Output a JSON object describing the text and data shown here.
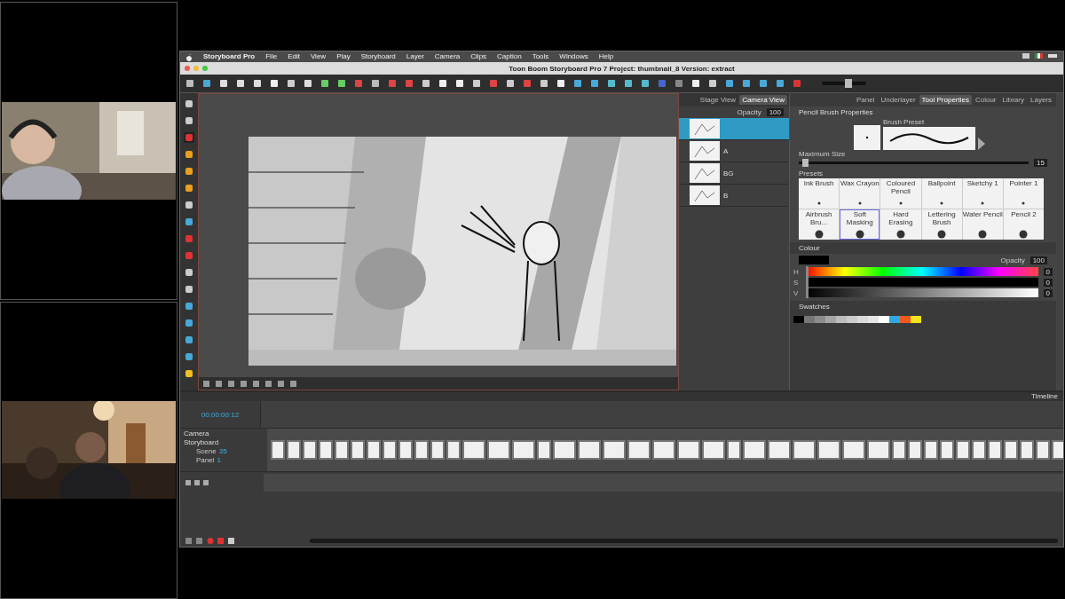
{
  "menu_bar": {
    "items": [
      "Storyboard Pro",
      "File",
      "Edit",
      "View",
      "Play",
      "Storyboard",
      "Layer",
      "Camera",
      "Clips",
      "Caption",
      "Tools",
      "Windows",
      "Help"
    ]
  },
  "toolbar": {
    "zoom": {
      "level": 0.6
    }
  },
  "window": {
    "title": "Toon Boom Storyboard Pro 7 Project: thumbnail_8 Version: extract"
  },
  "view_tabs": [
    {
      "label": "Stage View",
      "selected": false
    },
    {
      "label": "Camera View",
      "selected": true
    }
  ],
  "layers": {
    "opacity_label": "Opacity",
    "opacity": "100",
    "items": [
      {
        "selected": true
      },
      {
        "name": "A",
        "selected": false
      },
      {
        "name": "BG",
        "selected": false
      },
      {
        "name": "B",
        "selected": false
      }
    ]
  },
  "panel_tabs": [
    {
      "label": "Panel",
      "selected": false
    },
    {
      "label": "Underlayer",
      "selected": false
    },
    {
      "label": "Tool Properties",
      "selected": true
    },
    {
      "label": "Colour",
      "selected": false
    },
    {
      "label": "Library",
      "selected": false
    },
    {
      "label": "Layers",
      "selected": false
    }
  ],
  "tool_properties": {
    "title": "Pencil Brush Properties",
    "preset_label": "Brush Preset",
    "max_size_label": "Maximum Size",
    "max_size": "15",
    "size_slider": {
      "level": 0.02
    },
    "presets_label": "Presets",
    "presets": [
      {
        "name": "Ink Brush",
        "selected": false
      },
      {
        "name": "Wax Crayon",
        "selected": false
      },
      {
        "name": "Coloured Pencil",
        "selected": false
      },
      {
        "name": "Ballpoint",
        "selected": false
      },
      {
        "name": "Sketchy 1",
        "selected": false
      },
      {
        "name": "Pointer 1",
        "selected": false
      },
      {
        "name": "Airbrush Bru...",
        "selected": false
      },
      {
        "name": "Soft Masking",
        "selected": true
      },
      {
        "name": "Hard Erasing",
        "selected": false
      },
      {
        "name": "Lettering Brush",
        "selected": false
      },
      {
        "name": "Water Pencil",
        "selected": false
      },
      {
        "name": "Pencil 2",
        "selected": false
      }
    ]
  },
  "colour": {
    "title": "Colour",
    "opacity_label": "Opacity",
    "opacity": "100",
    "channels": [
      {
        "label": "H",
        "value": "0",
        "kind": "hue",
        "level": 0
      },
      {
        "label": "S",
        "value": "0",
        "kind": "saturation",
        "level": 0
      },
      {
        "label": "V",
        "value": "0",
        "kind": "value",
        "level": 0
      }
    ]
  },
  "swatches": {
    "title": "Swatches",
    "items": [
      {
        "color": "#000000"
      },
      {
        "color": "#777777"
      },
      {
        "color": "#8c8c8c"
      },
      {
        "color": "#a5a5a5"
      },
      {
        "color": "#bdbdbd"
      },
      {
        "color": "#cccccc"
      },
      {
        "color": "#dadada"
      },
      {
        "color": "#e6e6e6"
      },
      {
        "color": "#ffffff"
      },
      {
        "color": "#2ea8e6"
      },
      {
        "color": "#f05a1e"
      },
      {
        "color": "#f0e41e"
      }
    ]
  },
  "timeline": {
    "title": "Timeline",
    "timecode": "00:00:00:12",
    "tracks": [
      "Camera",
      "Storyboard"
    ],
    "scene_label": "Scene",
    "scene": "35",
    "panel_label": "Panel",
    "panel": "1"
  }
}
